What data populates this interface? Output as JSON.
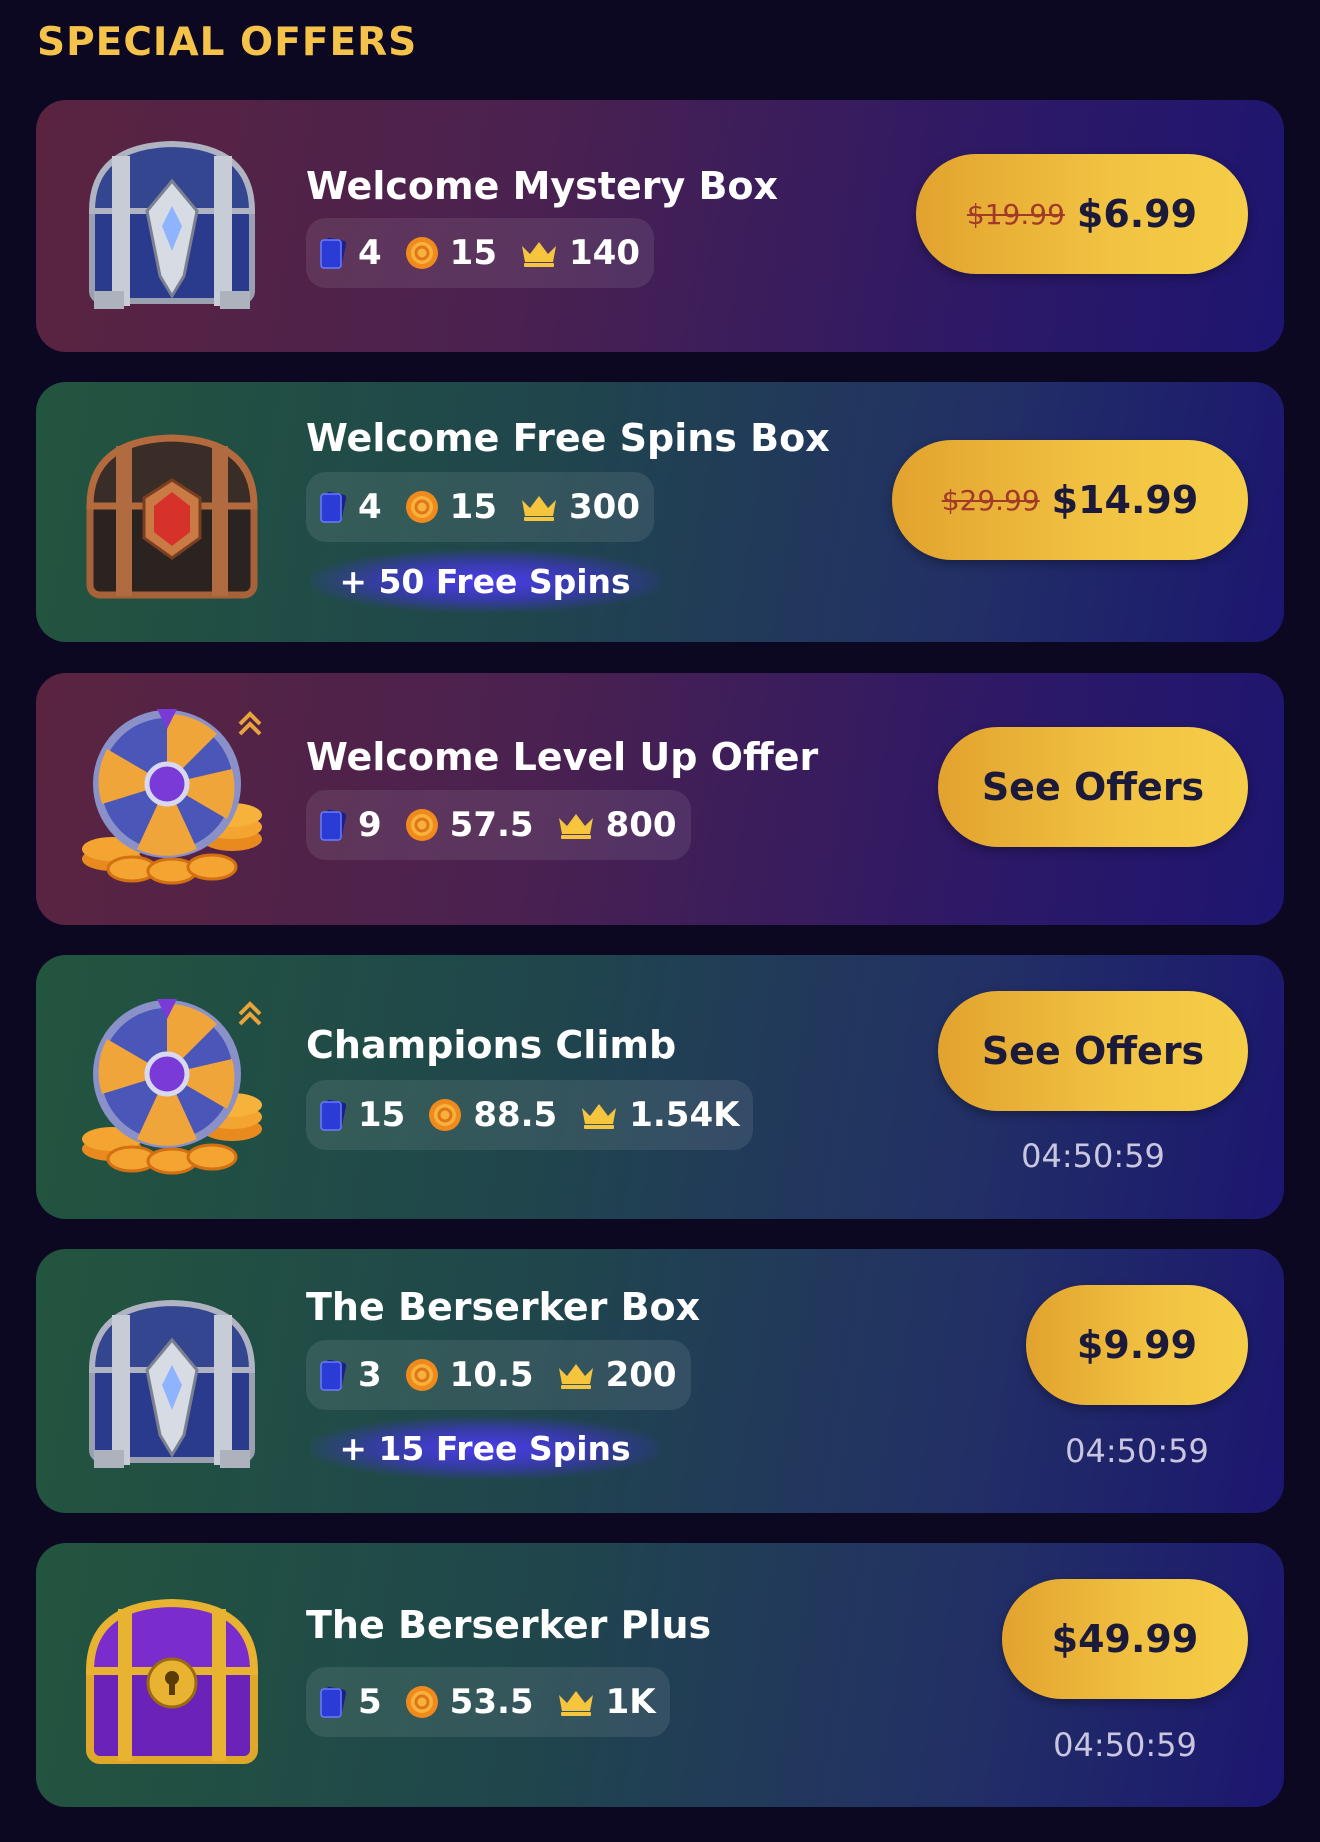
{
  "section_title": "SPECIAL OFFERS",
  "offers": [
    {
      "title": "Welcome Mystery Box",
      "cards": "4",
      "coins": "15",
      "crowns": "140",
      "old_price": "$19.99",
      "price": "$6.99"
    },
    {
      "title": "Welcome Free Spins Box",
      "cards": "4",
      "coins": "15",
      "crowns": "300",
      "bonus": "+ 50 Free Spins",
      "old_price": "$29.99",
      "price": "$14.99"
    },
    {
      "title": "Welcome Level Up Offer",
      "cards": "9",
      "coins": "57.5",
      "crowns": "800",
      "button": "See Offers"
    },
    {
      "title": "Champions Climb",
      "cards": "15",
      "coins": "88.5",
      "crowns": "1.54K",
      "button": "See Offers",
      "timer": "04:50:59"
    },
    {
      "title": "The Berserker Box",
      "cards": "3",
      "coins": "10.5",
      "crowns": "200",
      "bonus": "+ 15 Free Spins",
      "price": "$9.99",
      "timer": "04:50:59"
    },
    {
      "title": "The Berserker Plus",
      "cards": "5",
      "coins": "53.5",
      "crowns": "1K",
      "price": "$49.99",
      "timer": "04:50:59"
    }
  ],
  "icons": {
    "card": "card-icon",
    "coin": "coin-icon",
    "crown": "crown-icon"
  },
  "colors": {
    "accent": "#f5c34a",
    "button": "#f2c343",
    "background": "#0d0822"
  }
}
